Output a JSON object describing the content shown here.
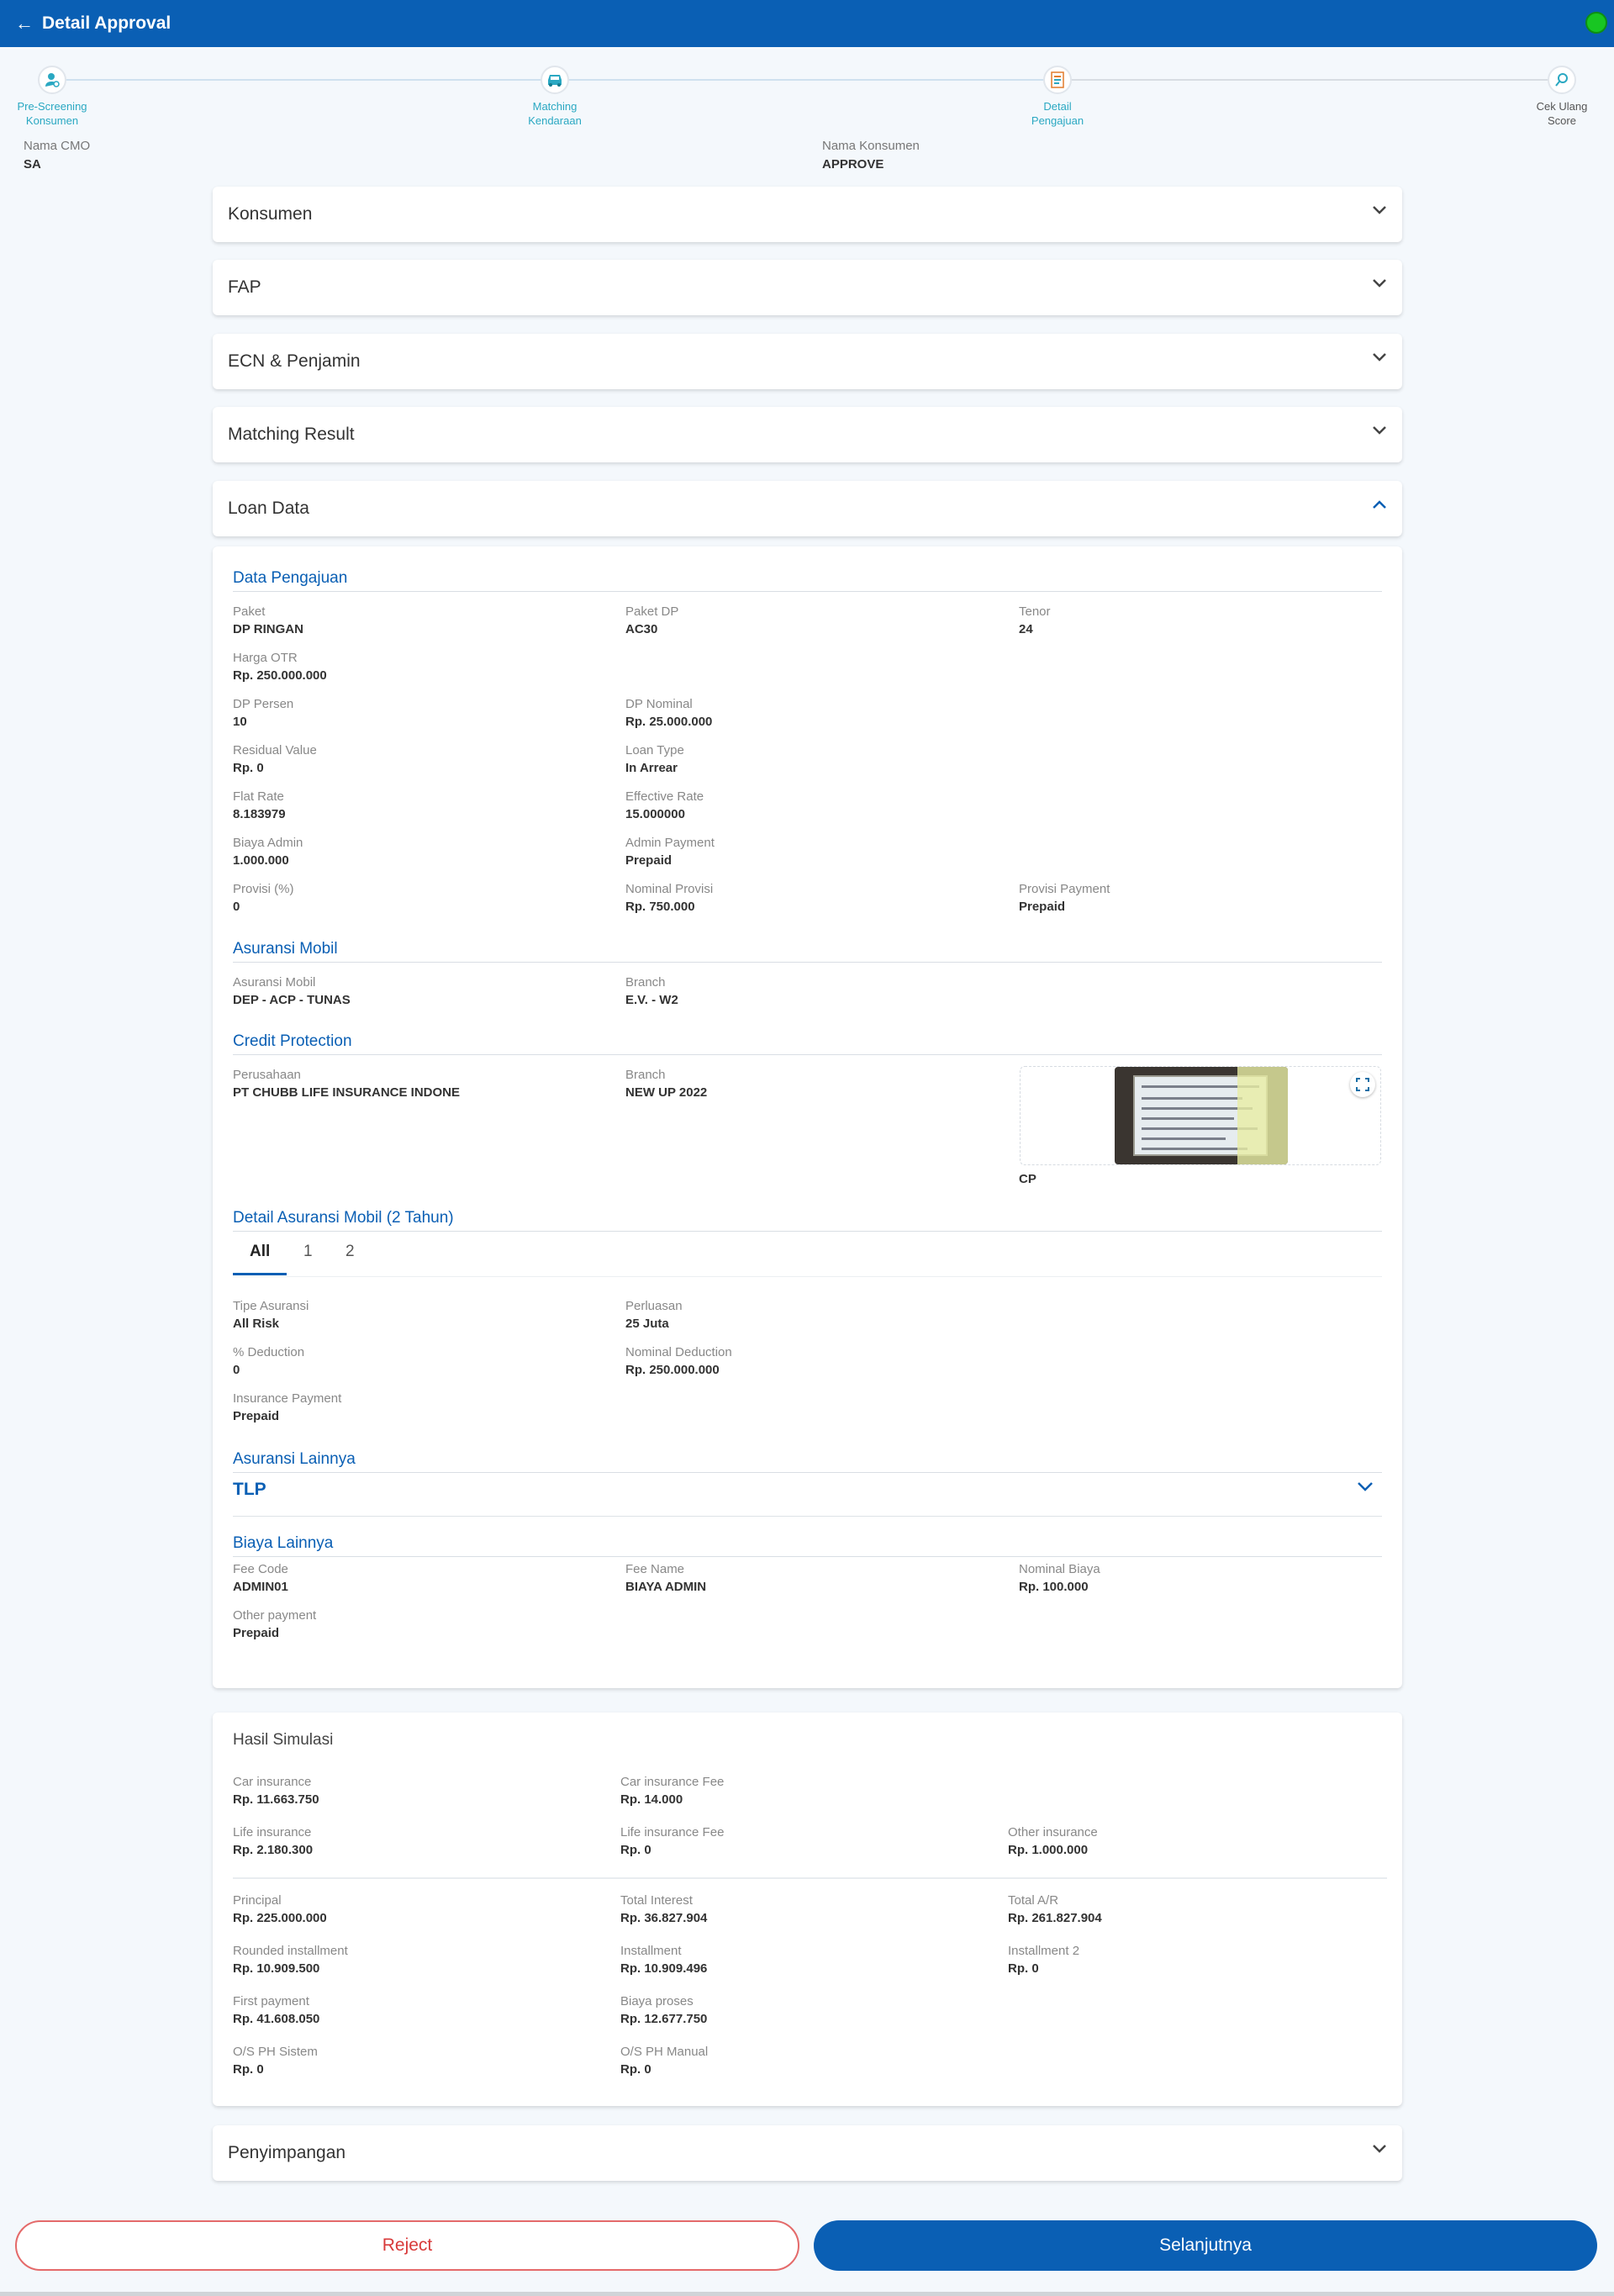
{
  "appbar": {
    "title": "Detail Approval"
  },
  "stepper": [
    {
      "label1": "Pre-Screening",
      "label2": "Konsumen"
    },
    {
      "label1": "Matching",
      "label2": "Kendaraan"
    },
    {
      "label1": "Detail",
      "label2": "Pengajuan"
    },
    {
      "label1": "Cek Ulang",
      "label2": "Score"
    }
  ],
  "header_info": {
    "cmo_label": "Nama CMO",
    "cmo_value": "SA",
    "konsumen_label": "Nama Konsumen",
    "konsumen_value": "APPROVE"
  },
  "accordions": {
    "konsumen": "Konsumen",
    "fap": "FAP",
    "ecn": "ECN & Penjamin",
    "matching": "Matching Result",
    "loan": "Loan Data",
    "penyimpangan": "Penyimpangan"
  },
  "loan": {
    "data_pengajuan_title": "Data Pengajuan",
    "paket_l": "Paket",
    "paket_v": "DP RINGAN",
    "paketdp_l": "Paket DP",
    "paketdp_v": "AC30",
    "tenor_l": "Tenor",
    "tenor_v": "24",
    "otr_l": "Harga OTR",
    "otr_v": "Rp. 250.000.000",
    "dppersen_l": "DP Persen",
    "dppersen_v": "10",
    "dpnominal_l": "DP Nominal",
    "dpnominal_v": "Rp. 25.000.000",
    "residual_l": "Residual Value",
    "residual_v": "Rp. 0",
    "loantype_l": "Loan Type",
    "loantype_v": "In Arrear",
    "flat_l": "Flat Rate",
    "flat_v": "8.183979",
    "eff_l": "Effective Rate",
    "eff_v": "15.000000",
    "badmin_l": "Biaya Admin",
    "badmin_v": "1.000.000",
    "adminpay_l": "Admin Payment",
    "adminpay_v": "Prepaid",
    "provisi_l": "Provisi (%)",
    "provisi_v": "0",
    "nomprov_l": "Nominal Provisi",
    "nomprov_v": "Rp. 750.000",
    "provpay_l": "Provisi Payment",
    "provpay_v": "Prepaid",
    "asuransi_title": "Asuransi Mobil",
    "asmobil_l": "Asuransi Mobil",
    "asmobil_v": "DEP - ACP - TUNAS",
    "branch1_l": "Branch",
    "branch1_v": "E.V. - W2",
    "cp_title": "Credit Protection",
    "perusahaan_l": "Perusahaan",
    "perusahaan_v": "PT CHUBB LIFE INSURANCE INDONE",
    "branch2_l": "Branch",
    "branch2_v": "NEW UP 2022",
    "cp_caption": "CP",
    "detail_as_title": "Detail Asuransi Mobil (2 Tahun)",
    "tabs": [
      "All",
      "1",
      "2"
    ],
    "tipe_l": "Tipe Asuransi",
    "tipe_v": "All Risk",
    "perluasan_l": "Perluasan",
    "perluasan_v": "25 Juta",
    "deduct_l": "% Deduction",
    "deduct_v": "0",
    "nomded_l": "Nominal Deduction",
    "nomded_v": "Rp. 250.000.000",
    "inspay_l": "Insurance Payment",
    "inspay_v": "Prepaid",
    "lainnya_title": "Asuransi Lainnya",
    "tlp": "TLP",
    "biaya_title": "Biaya Lainnya",
    "feecode_l": "Fee Code",
    "feecode_v": "ADMIN01",
    "feename_l": "Fee Name",
    "feename_v": "BIAYA ADMIN",
    "nombiaya_l": "Nominal Biaya",
    "nombiaya_v": "Rp. 100.000",
    "otherpay_l": "Other payment",
    "otherpay_v": "Prepaid"
  },
  "simulasi": {
    "title": "Hasil Simulasi",
    "carins_l": "Car insurance",
    "carins_v": "Rp. 11.663.750",
    "carfee_l": "Car insurance Fee",
    "carfee_v": "Rp. 14.000",
    "lifeins_l": "Life insurance",
    "lifeins_v": "Rp. 2.180.300",
    "lifefee_l": "Life insurance Fee",
    "lifefee_v": "Rp. 0",
    "other_l": "Other insurance",
    "other_v": "Rp. 1.000.000",
    "principal_l": "Principal",
    "principal_v": "Rp. 225.000.000",
    "interest_l": "Total Interest",
    "interest_v": "Rp. 36.827.904",
    "ar_l": "Total A/R",
    "ar_v": "Rp. 261.827.904",
    "rounded_l": "Rounded installment",
    "rounded_v": "Rp. 10.909.500",
    "inst_l": "Installment",
    "inst_v": "Rp. 10.909.496",
    "inst2_l": "Installment 2",
    "inst2_v": "Rp. 0",
    "first_l": "First payment",
    "first_v": "Rp. 41.608.050",
    "proses_l": "Biaya proses",
    "proses_v": "Rp. 12.677.750",
    "ossys_l": "O/S PH Sistem",
    "ossys_v": "Rp. 0",
    "osman_l": "O/S PH Manual",
    "osman_v": "Rp. 0"
  },
  "buttons": {
    "reject": "Reject",
    "next": "Selanjutnya"
  },
  "colors": {
    "primary": "#0a5fb4",
    "reject": "#d83a3a",
    "status": "#18c622"
  }
}
